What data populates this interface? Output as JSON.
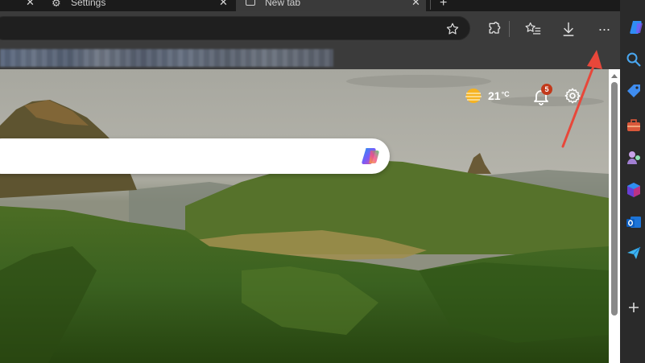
{
  "tabs": [
    {
      "label": "Settings",
      "active": false
    },
    {
      "label": "New tab",
      "active": true
    }
  ],
  "toolbar": {
    "favorite_icon": "star-icon",
    "extensions_icon": "extensions-icon",
    "collections_icon": "favorites-list-icon",
    "downloads_icon": "download-icon",
    "menu_icon": "more-dots-icon",
    "menu_label": "···"
  },
  "newtab": {
    "weather": {
      "temperature": "21",
      "unit": "°C",
      "icon": "sun-weather-icon"
    },
    "notifications": {
      "count": "5"
    },
    "search": {
      "placeholder": "",
      "icon": "copilot-icon"
    }
  },
  "sidebar": {
    "items": [
      {
        "name": "copilot",
        "icon": "copilot-icon"
      },
      {
        "name": "search",
        "icon": "search-icon"
      },
      {
        "name": "shopping",
        "icon": "tag-icon"
      },
      {
        "name": "tools",
        "icon": "toolbox-icon"
      },
      {
        "name": "games",
        "icon": "games-icon"
      },
      {
        "name": "microsoft-365",
        "icon": "m365-icon"
      },
      {
        "name": "outlook",
        "icon": "outlook-icon"
      },
      {
        "name": "drop",
        "icon": "send-icon"
      },
      {
        "name": "add",
        "icon": "plus-icon"
      }
    ]
  },
  "colors": {
    "accent_arrow": "#e8473a",
    "badge": "#c2391b",
    "toolbar": "#3b3b3b"
  }
}
